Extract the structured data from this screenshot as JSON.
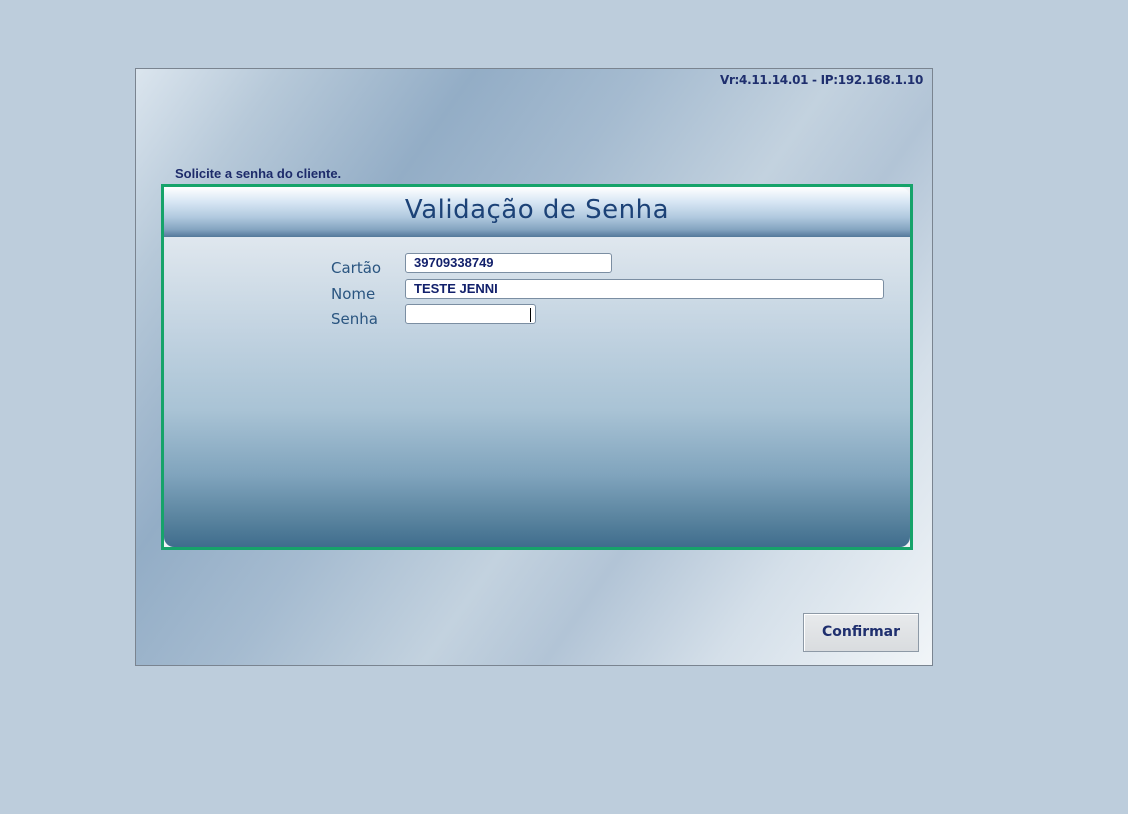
{
  "header": {
    "version_info": "Vr:4.11.14.01 - IP:192.168.1.10"
  },
  "instruction": "Solicite a senha do cliente.",
  "panel": {
    "title": "Validação de Senha"
  },
  "form": {
    "card": {
      "label": "Cartão",
      "value": "39709338749"
    },
    "name": {
      "label": "Nome",
      "value": "TESTE JENNI"
    },
    "password": {
      "label": "Senha",
      "value": ""
    }
  },
  "actions": {
    "confirm_label": "Confirmar"
  },
  "colors": {
    "frame_border": "#16a36a",
    "title_text": "#1c4277",
    "label_text": "#2a5580",
    "value_text": "#12206b"
  }
}
